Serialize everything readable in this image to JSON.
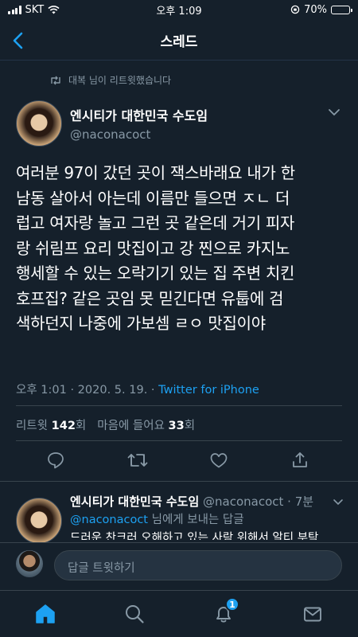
{
  "status_bar": {
    "carrier": "SKT",
    "time": "오후 1:09",
    "battery_percent": "70%",
    "battery_level": 0.7
  },
  "nav": {
    "title": "스레드",
    "back_icon": "chevron-left-icon"
  },
  "tweet": {
    "retweeted_by": "대복 님이 리트윗했습니다",
    "author_name": "엔시티가 대한민국 수도임",
    "author_handle": "@naconacoct",
    "body_lines": [
      "여러분 97이 갔던 곳이 잭스바래요 내가 한",
      "남동 살아서 아는데 이름만 들으면 ㅈㄴ 더",
      "럽고 여자랑 놀고 그런 곳 같은데 거기 피자",
      "랑 쉬림프 요리 맛집이고 강 찐으로 카지노",
      "행세할 수 있는 오락기기 있는 집 주변 치킨",
      "호프집? 같은 곳임 못 믿긴다면 유툽에 검",
      "색하던지 나중에 가보셈 ㄹㅇ 맛집이야"
    ],
    "timestamp": "오후 1:01 · 2020. 5. 19. · ",
    "source": "Twitter for iPhone",
    "retweets_label_before": "리트윗",
    "retweets_count": "142",
    "retweets_label_after": "회",
    "likes_label_before": "마음에 들어요",
    "likes_count": "33",
    "likes_label_after": "회"
  },
  "actions": [
    "reply-icon",
    "retweet-icon",
    "like-icon",
    "share-icon"
  ],
  "reply": {
    "author_name": "엔시티가 대한민국 수도임",
    "author_handle": "@naconacoct",
    "separator": " · ",
    "time_ago": "7분",
    "reply_to_mention": "@naconacoct",
    "reply_to_suffix": " 님에게 보내는 답글",
    "text_preview": "드러운 찬크러 오해하고 있는 사람 위해서 알티 부탁"
  },
  "compose": {
    "placeholder": "답글 트윗하기"
  },
  "tab_bar": {
    "items": [
      "home-icon",
      "search-icon",
      "notifications-icon",
      "messages-icon"
    ],
    "notification_badge": "1"
  },
  "colors": {
    "background": "#15202b",
    "accent": "#1da1f2",
    "secondary_text": "#8899a6",
    "divider": "#38444d",
    "battery_fill": "#4cd964"
  }
}
